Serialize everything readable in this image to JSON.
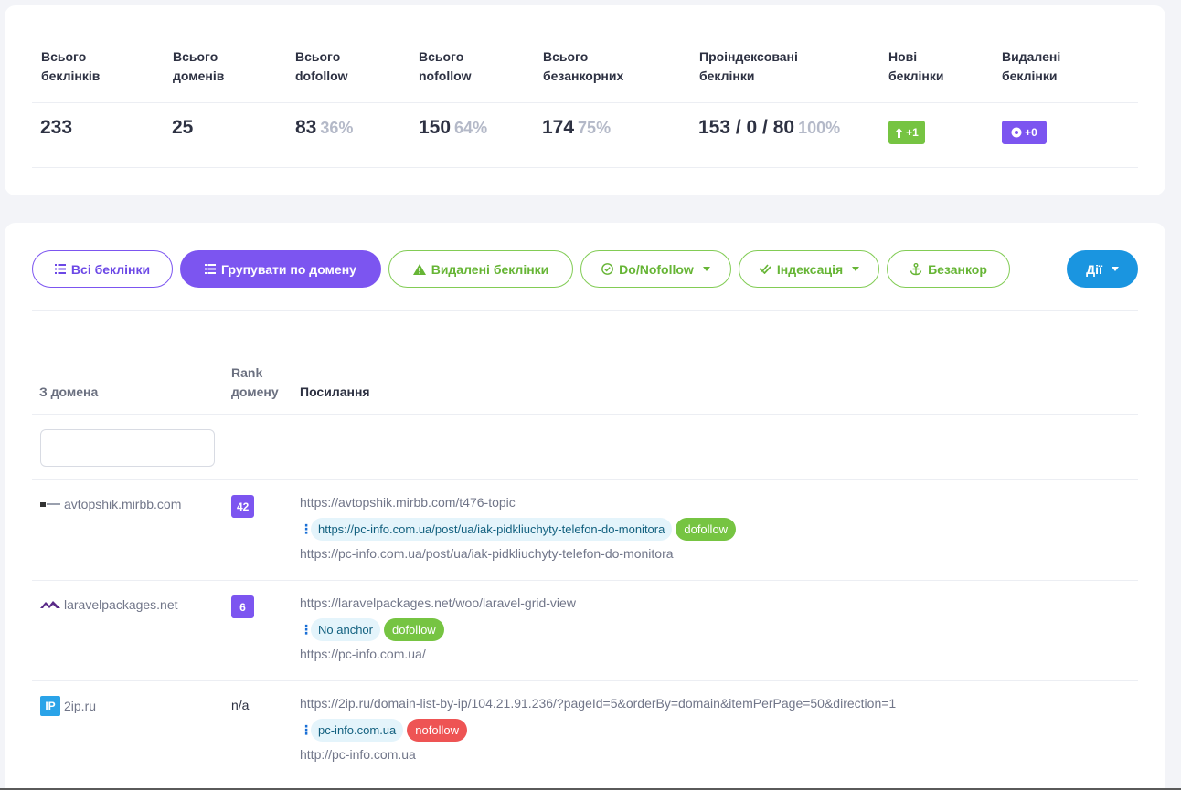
{
  "stats": [
    {
      "label": "Всього\nбеклінків",
      "value": "233",
      "pct": ""
    },
    {
      "label": "Всього\nдоменів",
      "value": "25",
      "pct": ""
    },
    {
      "label": "Всього\ndofollow",
      "value": "83",
      "pct": "36%"
    },
    {
      "label": "Всього\nnofollow",
      "value": "150",
      "pct": "64%"
    },
    {
      "label": "Всього\nбезанкорних",
      "value": "174",
      "pct": "75%"
    },
    {
      "label": "Проіндексовані\nбеклінки",
      "value": "153 / 0 / 80",
      "pct": "100%"
    },
    {
      "label": "Нові\nбеклінки",
      "badge": "+1",
      "badge_icon": "arrow-up-icon"
    },
    {
      "label": "Видалені\nбеклінки",
      "badge": "+0",
      "badge_icon": "circle-icon"
    }
  ],
  "filters": {
    "all": "Всі беклінки",
    "group": "Групувати по домену",
    "deleted": "Видалені беклінки",
    "dofollow": "Do/Nofollow",
    "index": "Індексація",
    "noanchor": "Безанкор",
    "actions": "Дії"
  },
  "table": {
    "col_domain": "З домена",
    "col_rank": "Rank\nдомену",
    "col_link": "Посилання",
    "filter_placeholder": ""
  },
  "rows": [
    {
      "domain": "avtopshik.mirbb.com",
      "rank": "42",
      "source": "https://avtopshik.mirbb.com/t476-topic",
      "anchor": "https://pc-info.com.ua/post/ua/iak-pidkliuchyty-telefon-do-monitora",
      "follow": "dofollow",
      "target": "https://pc-info.com.ua/post/ua/iak-pidkliuchyty-telefon-do-monitora"
    },
    {
      "domain": "laravelpackages.net",
      "rank": "6",
      "source": "https://laravelpackages.net/woo/laravel-grid-view",
      "anchor": "No anchor",
      "follow": "dofollow",
      "target": "https://pc-info.com.ua/"
    },
    {
      "domain": "2ip.ru",
      "rank": "n/a",
      "source": "https://2ip.ru/domain-list-by-ip/104.21.91.236/?pageId=5&orderBy=domain&itemPerPage=50&direction=1",
      "anchor": "pc-info.com.ua",
      "follow": "nofollow",
      "target": "http://pc-info.com.ua",
      "favicon_text": "IP"
    }
  ],
  "colors": {
    "purple": "#7c55f0",
    "green": "#76c442",
    "red": "#ee5454",
    "blue": "#1a95e0"
  }
}
